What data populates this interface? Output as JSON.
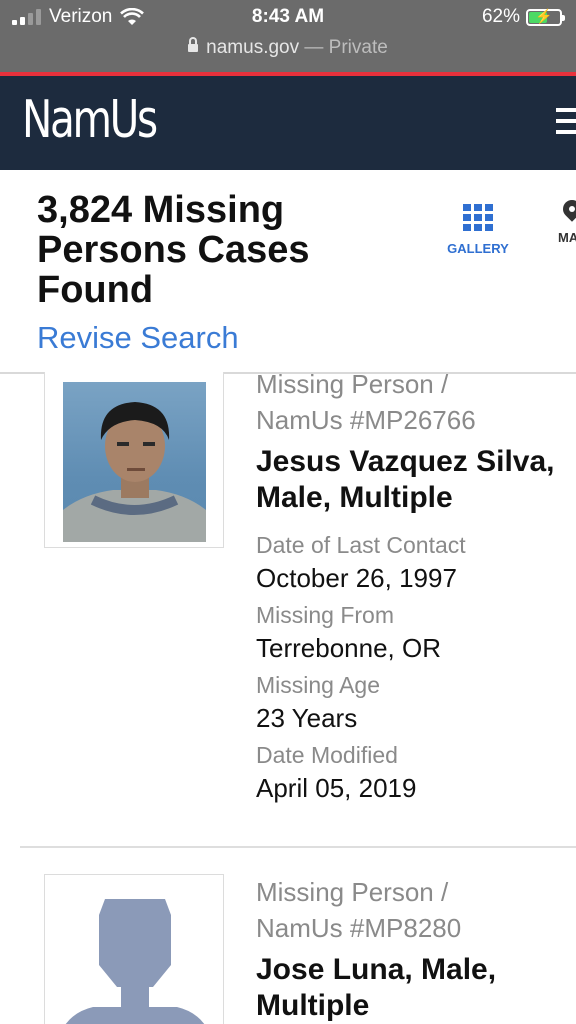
{
  "status_bar": {
    "carrier": "Verizon",
    "time": "8:43 AM",
    "battery": "62%",
    "battery_level": 0.62,
    "url": "namus.gov",
    "privacy": "— Private"
  },
  "header": {
    "logo": "NamUs"
  },
  "results": {
    "count_line": "3,824 Missing Persons Cases Found",
    "revise_label": "Revise Search",
    "views": [
      {
        "label": "GALLERY",
        "icon": "grid-icon"
      },
      {
        "label": "MAP",
        "icon": "map-pin-icon"
      }
    ]
  },
  "cases": [
    {
      "case_type": "Missing Person /",
      "case_number": "NamUs #MP26766",
      "name": "Jesus Vazquez Silva, Male, Multiple",
      "fields": [
        {
          "label": "Date of Last Contact",
          "value": "October 26, 1997"
        },
        {
          "label": "Missing From",
          "value": "Terrebonne, OR"
        },
        {
          "label": "Missing Age",
          "value": "23 Years"
        },
        {
          "label": "Date Modified",
          "value": "April 05, 2019"
        }
      ]
    },
    {
      "case_type": "Missing Person /",
      "case_number": "NamUs #MP8280",
      "name": "Jose Luna, Male, Multiple"
    }
  ]
}
